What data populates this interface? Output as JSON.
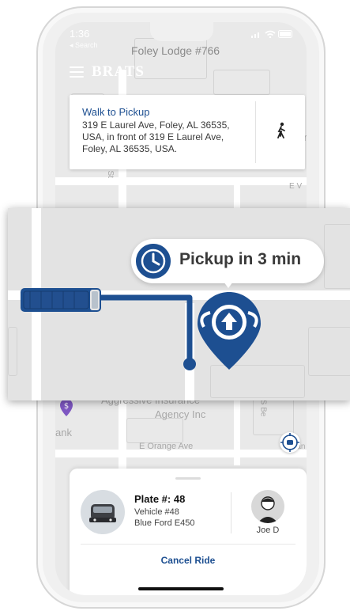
{
  "status": {
    "time": "1:36",
    "back_label": "◂ Search"
  },
  "header": {
    "brand": "BRATS",
    "venue": "Foley Lodge #766"
  },
  "map_labels": {
    "agency_line1": "Aggressive Insurance",
    "agency_line2": "Agency Inc",
    "bank": "ank",
    "orange_ave": "E Orange Ave",
    "s_st": "S St",
    "e_v": "E V",
    "ner": "ner",
    "s_be": "S Be",
    "ran": "ran",
    "rtl": "rtl"
  },
  "walk_card": {
    "title": "Walk to Pickup",
    "address": "319 E Laurel Ave, Foley, AL 36535, USA, in front of 319 E Laurel Ave, Foley, AL 36535, USA."
  },
  "pickup": {
    "label": "Pickup in 3 min"
  },
  "vehicle": {
    "plate": "Plate #: 48",
    "vehicle_no": "Vehicle #48",
    "model": "Blue Ford E450"
  },
  "driver": {
    "name": "Joe D"
  },
  "actions": {
    "cancel_label": "Cancel Ride"
  },
  "colors": {
    "brand_blue": "#1d4f91",
    "map_bg": "#e9e9e9",
    "route_blue": "#1d4f91"
  }
}
